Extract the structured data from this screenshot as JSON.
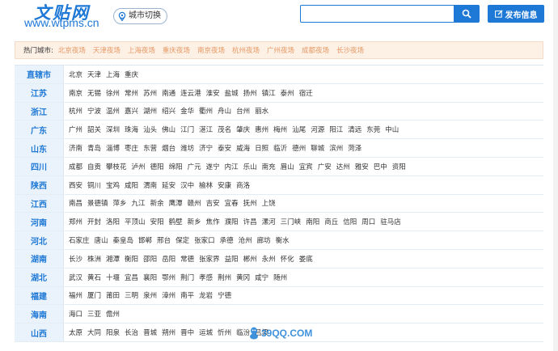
{
  "header": {
    "logo_cn": "文贴网",
    "logo_url": "www.wtpms.cn",
    "city_switch_label": "城市切换",
    "search_placeholder": "",
    "post_label": "发布信息"
  },
  "hot_cities": {
    "label": "热门城市:",
    "items": [
      "北京夜场",
      "天津夜场",
      "上海夜场",
      "重庆夜场",
      "南京夜场",
      "杭州夜场",
      "广州夜场",
      "成都夜场",
      "长沙夜场"
    ]
  },
  "provinces": [
    {
      "name": "直辖市",
      "cities": [
        "北京",
        "天津",
        "上海",
        "重庆"
      ]
    },
    {
      "name": "江苏",
      "cities": [
        "南京",
        "无锡",
        "徐州",
        "常州",
        "苏州",
        "南通",
        "连云港",
        "淮安",
        "盐城",
        "扬州",
        "镇江",
        "泰州",
        "宿迁"
      ]
    },
    {
      "name": "浙江",
      "cities": [
        "杭州",
        "宁波",
        "温州",
        "嘉兴",
        "湖州",
        "绍兴",
        "金华",
        "衢州",
        "舟山",
        "台州",
        "丽水"
      ]
    },
    {
      "name": "广东",
      "cities": [
        "广州",
        "韶关",
        "深圳",
        "珠海",
        "汕头",
        "佛山",
        "江门",
        "湛江",
        "茂名",
        "肇庆",
        "惠州",
        "梅州",
        "汕尾",
        "河源",
        "阳江",
        "清远",
        "东莞",
        "中山"
      ]
    },
    {
      "name": "山东",
      "cities": [
        "济南",
        "青岛",
        "淄博",
        "枣庄",
        "东营",
        "烟台",
        "潍坊",
        "济宁",
        "泰安",
        "威海",
        "日照",
        "临沂",
        "德州",
        "聊城",
        "滨州",
        "菏泽"
      ]
    },
    {
      "name": "四川",
      "cities": [
        "成都",
        "自贡",
        "攀枝花",
        "泸州",
        "德阳",
        "绵阳",
        "广元",
        "遂宁",
        "内江",
        "乐山",
        "南充",
        "眉山",
        "宜宾",
        "广安",
        "达州",
        "雅安",
        "巴中",
        "资阳"
      ]
    },
    {
      "name": "陕西",
      "cities": [
        "西安",
        "铜川",
        "宝鸡",
        "咸阳",
        "渭南",
        "延安",
        "汉中",
        "榆林",
        "安康",
        "商洛"
      ]
    },
    {
      "name": "江西",
      "cities": [
        "南昌",
        "景德镇",
        "萍乡",
        "九江",
        "新余",
        "鹰潭",
        "赣州",
        "吉安",
        "宜春",
        "抚州",
        "上饶"
      ]
    },
    {
      "name": "河南",
      "cities": [
        "郑州",
        "开封",
        "洛阳",
        "平顶山",
        "安阳",
        "鹤壁",
        "新乡",
        "焦作",
        "濮阳",
        "许昌",
        "漯河",
        "三门峡",
        "南阳",
        "商丘",
        "信阳",
        "周口",
        "驻马店"
      ]
    },
    {
      "name": "河北",
      "cities": [
        "石家庄",
        "唐山",
        "秦皇岛",
        "邯郸",
        "邢台",
        "保定",
        "张家口",
        "承德",
        "沧州",
        "廊坊",
        "衡水"
      ]
    },
    {
      "name": "湖南",
      "cities": [
        "长沙",
        "株洲",
        "湘潭",
        "衡阳",
        "邵阳",
        "岳阳",
        "常德",
        "张家界",
        "益阳",
        "郴州",
        "永州",
        "怀化",
        "娄底"
      ]
    },
    {
      "name": "湖北",
      "cities": [
        "武汉",
        "黄石",
        "十堰",
        "宜昌",
        "襄阳",
        "鄂州",
        "荆门",
        "孝感",
        "荆州",
        "黄冈",
        "咸宁",
        "随州"
      ]
    },
    {
      "name": "福建",
      "cities": [
        "福州",
        "厦门",
        "莆田",
        "三明",
        "泉州",
        "漳州",
        "南平",
        "龙岩",
        "宁德"
      ]
    },
    {
      "name": "海南",
      "cities": [
        "海口",
        "三亚",
        "儋州"
      ]
    },
    {
      "name": "山西",
      "cities": [
        "太原",
        "大同",
        "阳泉",
        "长治",
        "晋城",
        "朔州",
        "晋中",
        "运城",
        "忻州",
        "临汾",
        "吕梁"
      ]
    }
  ],
  "watermark": "39QQ.COM",
  "colors": {
    "brand_blue": "#1e78d6",
    "hot_link": "#e59a66",
    "province_bg": "#eaf3fb"
  }
}
